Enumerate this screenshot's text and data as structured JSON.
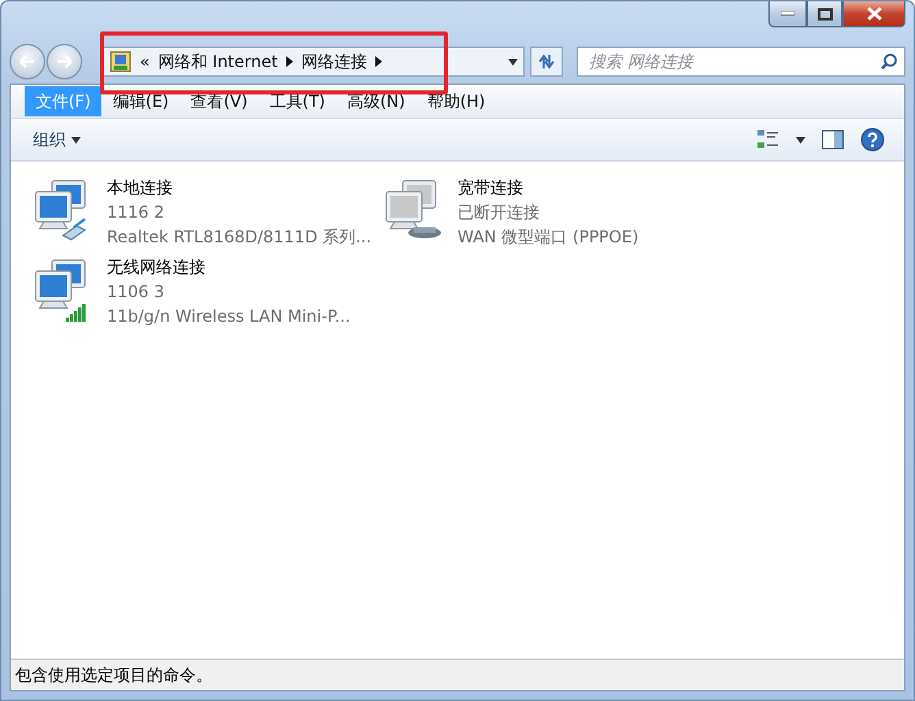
{
  "address": {
    "overflow": "«",
    "crumbs": [
      "网络和 Internet",
      "网络连接"
    ]
  },
  "search": {
    "placeholder": "搜索 网络连接"
  },
  "menu": [
    {
      "label": "文件(F)",
      "selected": true
    },
    {
      "label": "编辑(E)",
      "selected": false
    },
    {
      "label": "查看(V)",
      "selected": false
    },
    {
      "label": "工具(T)",
      "selected": false
    },
    {
      "label": "高级(N)",
      "selected": false
    },
    {
      "label": "帮助(H)",
      "selected": false
    }
  ],
  "toolbar": {
    "organize": "组织"
  },
  "connections": [
    {
      "kind": "lan",
      "name": "本地连接",
      "status": "1116  2",
      "device": "Realtek RTL8168D/8111D 系列..."
    },
    {
      "kind": "broadband",
      "name": "宽带连接",
      "status": "已断开连接",
      "device": "WAN 微型端口 (PPPOE)"
    },
    {
      "kind": "wireless",
      "name": "无线网络连接",
      "status": "1106  3",
      "device": "11b/g/n  Wireless LAN Mini-P..."
    }
  ],
  "status_bar": "包含使用选定项目的命令。"
}
